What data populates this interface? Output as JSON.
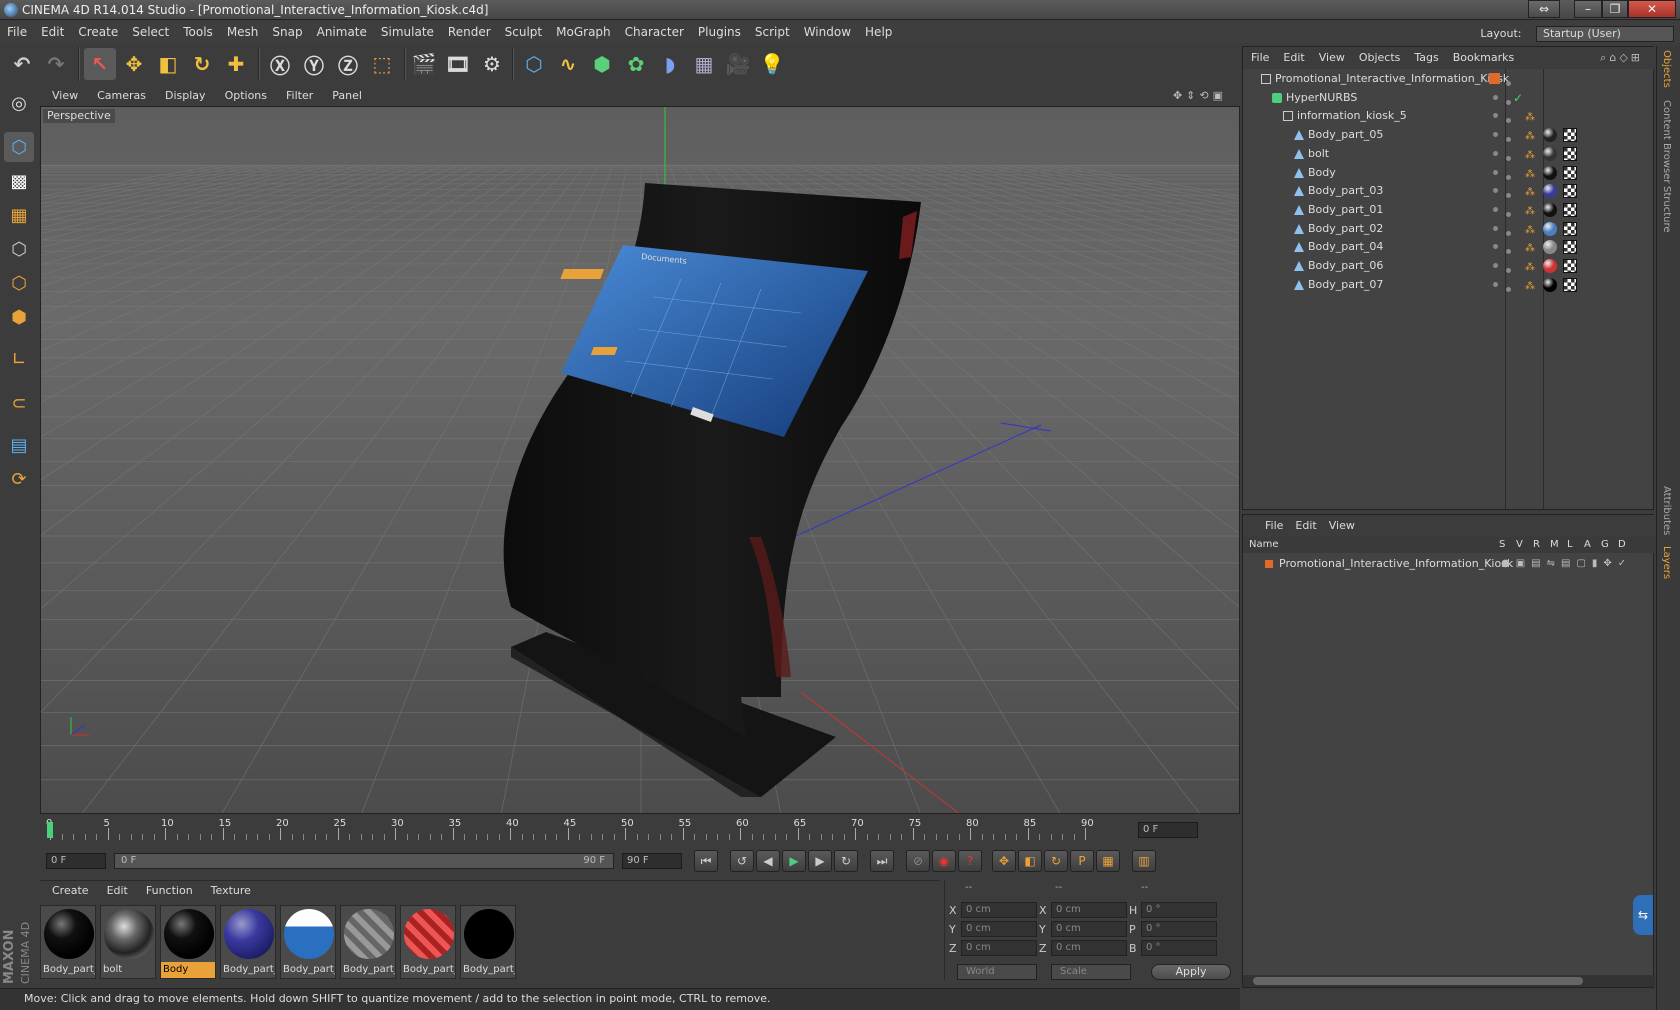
{
  "window": {
    "title": "CINEMA 4D R14.014 Studio - [Promotional_Interactive_Information_Kiosk.c4d]"
  },
  "menubar": {
    "items": [
      "File",
      "Edit",
      "Create",
      "Select",
      "Tools",
      "Mesh",
      "Snap",
      "Animate",
      "Simulate",
      "Render",
      "Sculpt",
      "MoGraph",
      "Character",
      "Plugins",
      "Script",
      "Window",
      "Help"
    ],
    "layout_label": "Layout:",
    "layout_value": "Startup (User)"
  },
  "viewport": {
    "menu": [
      "View",
      "Cameras",
      "Display",
      "Options",
      "Filter",
      "Panel"
    ],
    "label": "Perspective"
  },
  "timeline": {
    "ticks": [
      "0",
      "5",
      "10",
      "15",
      "20",
      "25",
      "30",
      "35",
      "40",
      "45",
      "50",
      "55",
      "60",
      "65",
      "70",
      "75",
      "80",
      "85",
      "90"
    ],
    "current_frame": "0 F"
  },
  "playbar": {
    "start_field": "0 F",
    "range_start": "0 F",
    "range_end": "90 F",
    "end_field": "90 F"
  },
  "materials": {
    "menu": [
      "Create",
      "Edit",
      "Function",
      "Texture"
    ],
    "items": [
      {
        "label": "Body_part_",
        "style": "black"
      },
      {
        "label": "bolt",
        "style": "chrome"
      },
      {
        "label": "Body",
        "style": "black",
        "selected": true
      },
      {
        "label": "Body_part_",
        "style": "blue"
      },
      {
        "label": "Body_part_",
        "style": "screen"
      },
      {
        "label": "Body_part_",
        "style": "grey"
      },
      {
        "label": "Body_part_",
        "style": "red"
      },
      {
        "label": "Body_part_",
        "style": "matte"
      }
    ]
  },
  "coords": {
    "headers": [
      "--",
      "--",
      "--"
    ],
    "rows": [
      {
        "a": "X",
        "av": "0 cm",
        "b": "X",
        "bv": "0 cm",
        "c": "H",
        "cv": "0 °"
      },
      {
        "a": "Y",
        "av": "0 cm",
        "b": "Y",
        "bv": "0 cm",
        "c": "P",
        "cv": "0 °"
      },
      {
        "a": "Z",
        "av": "0 cm",
        "b": "Z",
        "bv": "0 cm",
        "c": "B",
        "cv": "0 °"
      }
    ],
    "space": "World",
    "mode": "Scale",
    "apply": "Apply"
  },
  "objects": {
    "menu": [
      "File",
      "Edit",
      "View",
      "Objects",
      "Tags",
      "Bookmarks"
    ],
    "rows": [
      {
        "name": "Promotional_Interactive_Information_Kiosk",
        "indent": 0,
        "icon": "null"
      },
      {
        "name": "HyperNURBS",
        "indent": 1,
        "icon": "nurbs"
      },
      {
        "name": "information_kiosk_5",
        "indent": 2,
        "icon": "null"
      },
      {
        "name": "Body_part_05",
        "indent": 3,
        "icon": "poly",
        "tag": "#222"
      },
      {
        "name": "bolt",
        "indent": 3,
        "icon": "poly",
        "tag": "#333"
      },
      {
        "name": "Body",
        "indent": 3,
        "icon": "poly",
        "tag": "#111"
      },
      {
        "name": "Body_part_03",
        "indent": 3,
        "icon": "poly",
        "tag": "#3a3a9a"
      },
      {
        "name": "Body_part_01",
        "indent": 3,
        "icon": "poly",
        "tag": "#111"
      },
      {
        "name": "Body_part_02",
        "indent": 3,
        "icon": "poly",
        "tag": "#4a7fc0"
      },
      {
        "name": "Body_part_04",
        "indent": 3,
        "icon": "poly",
        "tag": "#888"
      },
      {
        "name": "Body_part_06",
        "indent": 3,
        "icon": "poly",
        "tag": "#c33"
      },
      {
        "name": "Body_part_07",
        "indent": 3,
        "icon": "poly",
        "tag": "#000"
      }
    ]
  },
  "layers": {
    "menu": [
      "File",
      "Edit",
      "View"
    ],
    "header": {
      "name": "Name",
      "cols": [
        "S",
        "V",
        "R",
        "M",
        "L",
        "A",
        "G",
        "D"
      ]
    },
    "rows": [
      {
        "name": "Promotional_Interactive_Information_Kiosk"
      }
    ]
  },
  "side_tabs": [
    "Objects",
    "Content Browser",
    "Structure",
    "Attributes",
    "Layers"
  ],
  "brand": {
    "line1": "MAXON",
    "line2": "CINEMA 4D"
  },
  "status": {
    "text": "Move: Click and drag to move elements. Hold down SHIFT to quantize movement / add to the selection in point mode, CTRL to remove."
  },
  "screen": {
    "heading": "Documents"
  },
  "colors": {
    "accent": "#e8a23a",
    "bg": "#3c3c3c",
    "panel": "#434343"
  }
}
